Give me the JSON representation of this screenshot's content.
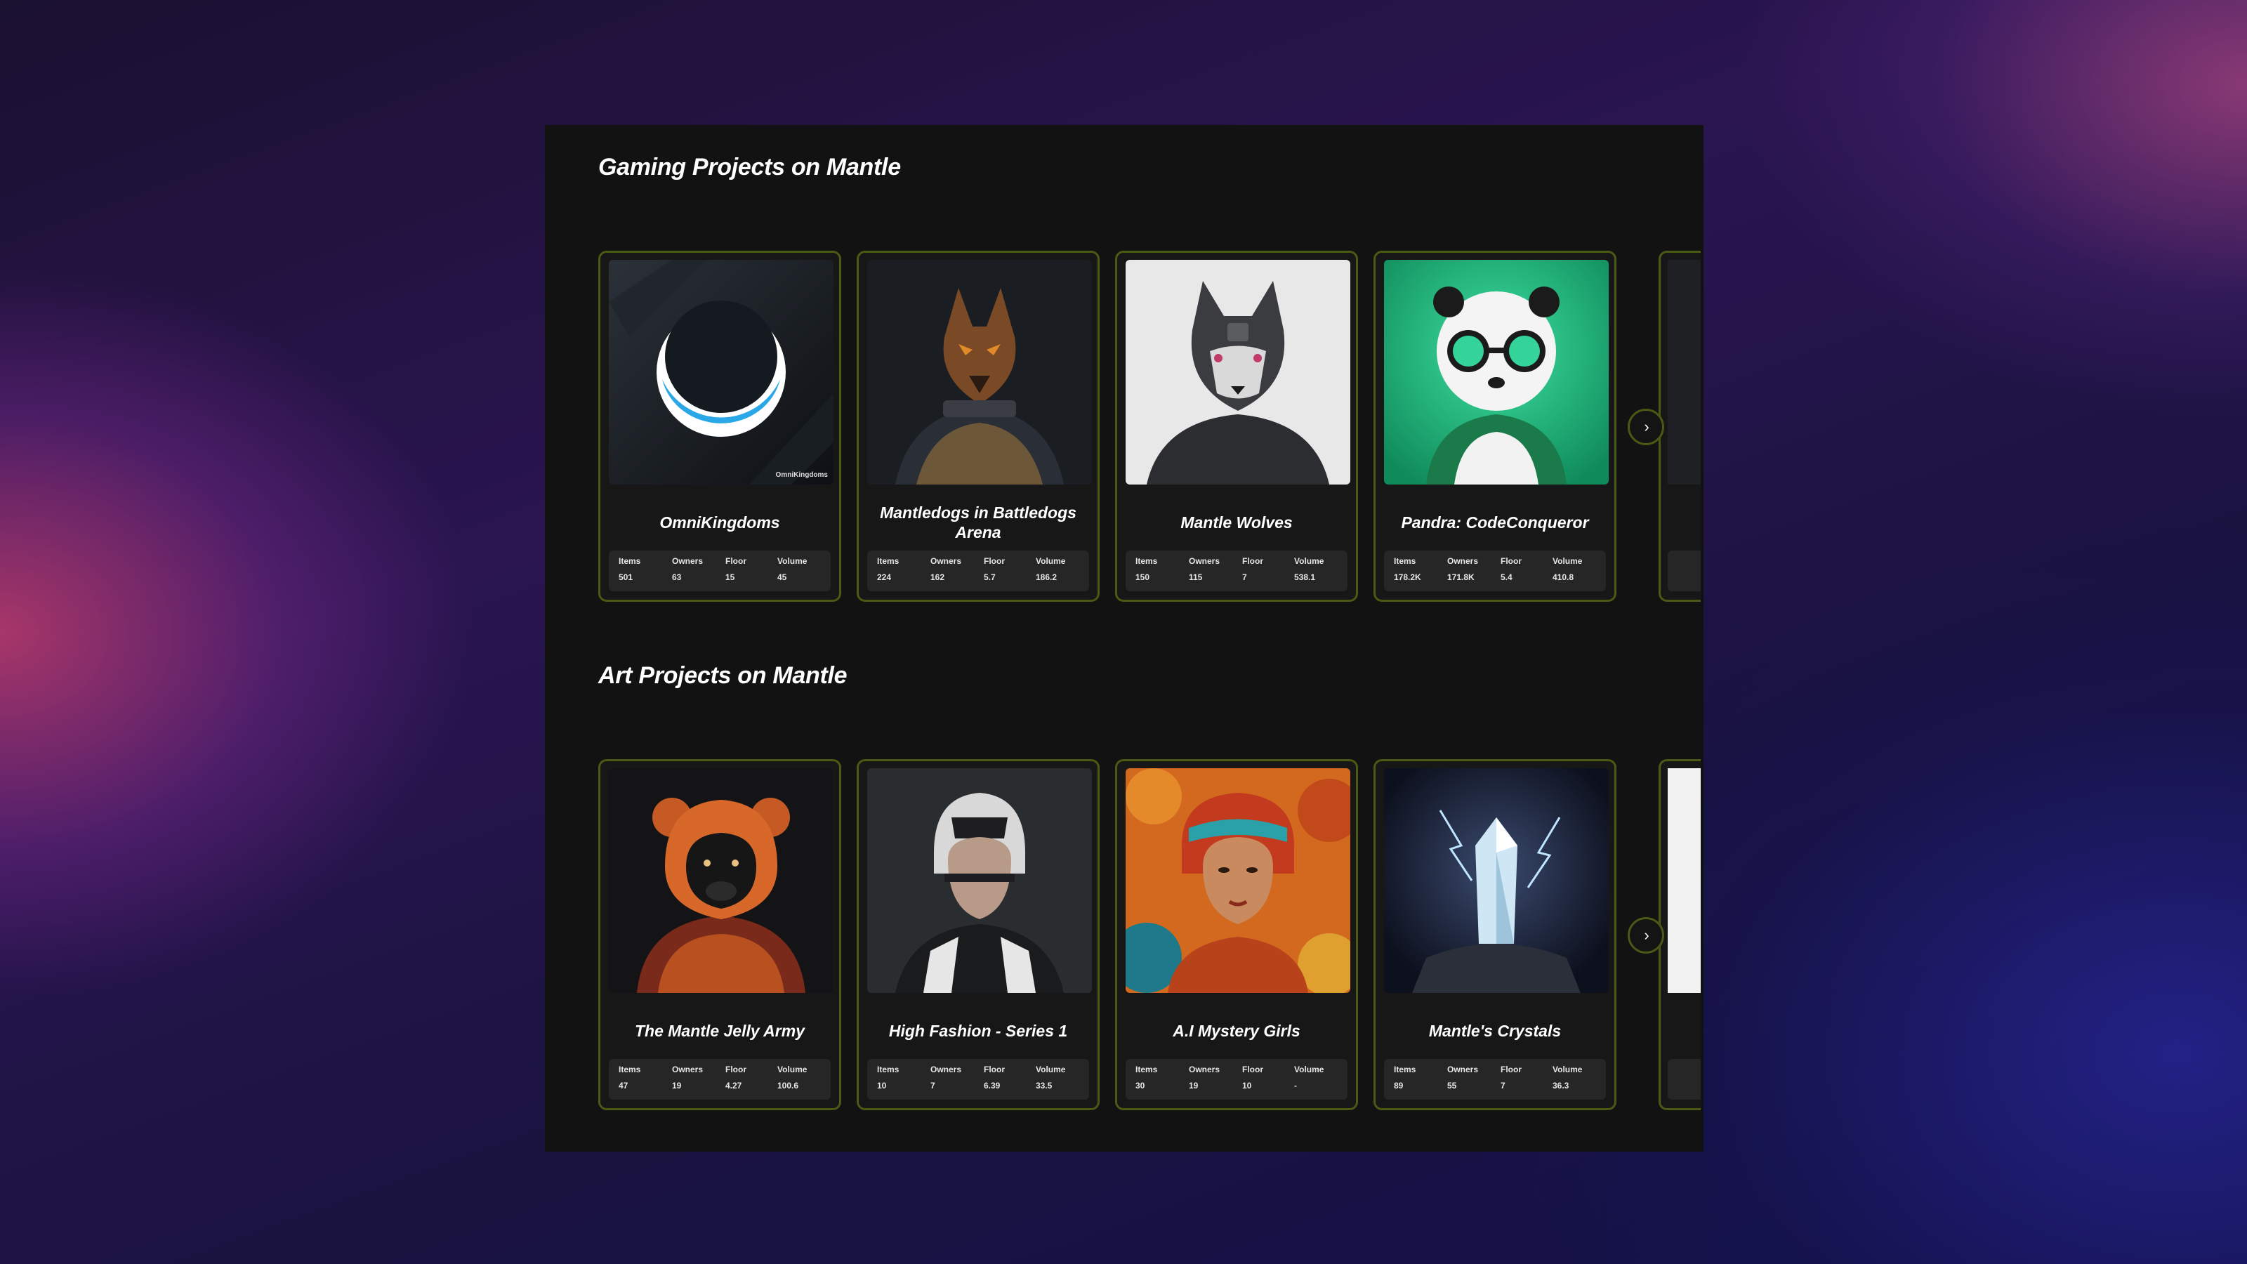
{
  "sections": [
    {
      "title": "Gaming Projects on Mantle",
      "cards": [
        {
          "name": "OmniKingdoms",
          "logo_text": "OmniKingdoms",
          "stats": {
            "items": "501",
            "owners": "63",
            "floor": "15",
            "volume": "45"
          }
        },
        {
          "name": "Mantledogs in Battledogs Arena",
          "stats": {
            "items": "224",
            "owners": "162",
            "floor": "5.7",
            "volume": "186.2"
          }
        },
        {
          "name": "Mantle Wolves",
          "stats": {
            "items": "150",
            "owners": "115",
            "floor": "7",
            "volume": "538.1"
          }
        },
        {
          "name": "Pandra: CodeConqueror",
          "stats": {
            "items": "178.2K",
            "owners": "171.8K",
            "floor": "5.4",
            "volume": "410.8"
          }
        }
      ]
    },
    {
      "title": "Art Projects on Mantle",
      "cards": [
        {
          "name": "The Mantle Jelly Army",
          "stats": {
            "items": "47",
            "owners": "19",
            "floor": "4.27",
            "volume": "100.6"
          }
        },
        {
          "name": "High Fashion - Series 1",
          "stats": {
            "items": "10",
            "owners": "7",
            "floor": "6.39",
            "volume": "33.5"
          }
        },
        {
          "name": "A.I Mystery Girls",
          "stats": {
            "items": "30",
            "owners": "19",
            "floor": "10",
            "volume": "-"
          }
        },
        {
          "name": "Mantle's Crystals",
          "stats": {
            "items": "89",
            "owners": "55",
            "floor": "7",
            "volume": "36.3"
          }
        }
      ]
    }
  ],
  "stat_labels": {
    "items": "Items",
    "owners": "Owners",
    "floor": "Floor",
    "volume": "Volume"
  },
  "colors": {
    "panel": "#121212",
    "card_border": "#4a5a14",
    "stats_bg": "#262626",
    "text": "#ffffff"
  },
  "icons": {
    "next": "chevron-right-icon"
  }
}
